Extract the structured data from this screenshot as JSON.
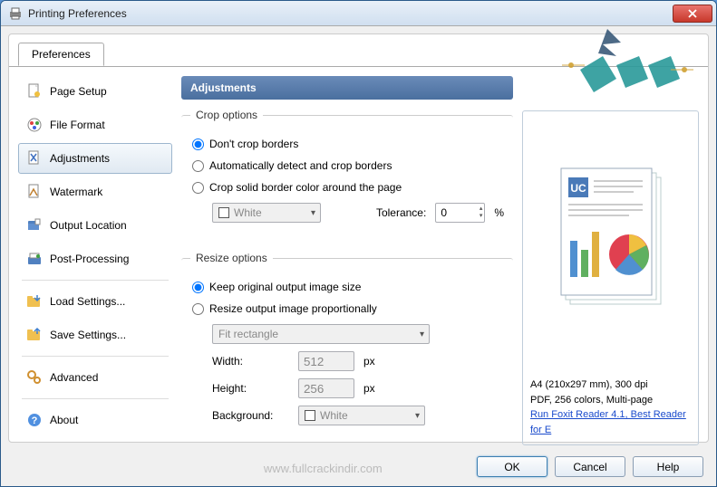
{
  "window": {
    "title": "Printing Preferences"
  },
  "tab": {
    "label": "Preferences"
  },
  "nav": {
    "page_setup": "Page Setup",
    "file_format": "File Format",
    "adjustments": "Adjustments",
    "watermark": "Watermark",
    "output_location": "Output Location",
    "post_processing": "Post-Processing",
    "load_settings": "Load Settings...",
    "save_settings": "Save Settings...",
    "advanced": "Advanced",
    "about": "About"
  },
  "header": "Adjustments",
  "crop": {
    "legend": "Crop options",
    "opt1": "Don't crop borders",
    "opt2": "Automatically detect and crop borders",
    "opt3": "Crop solid border color around the page",
    "color": "White",
    "tolerance_label": "Tolerance:",
    "tolerance_value": "0",
    "tolerance_unit": "%"
  },
  "resize": {
    "legend": "Resize options",
    "opt1": "Keep original output image size",
    "opt2": "Resize output image proportionally",
    "fit": "Fit rectangle",
    "width_label": "Width:",
    "width_value": "512",
    "height_label": "Height:",
    "height_value": "256",
    "unit": "px",
    "background_label": "Background:",
    "background_value": "White"
  },
  "preview": {
    "line1": "A4 (210x297 mm), 300 dpi",
    "line2": "PDF, 256 colors, Multi-page",
    "link": "Run Foxit Reader 4.1, Best Reader for E"
  },
  "buttons": {
    "ok": "OK",
    "cancel": "Cancel",
    "help": "Help"
  },
  "watermark_text": "www.fullcrackindir.com"
}
